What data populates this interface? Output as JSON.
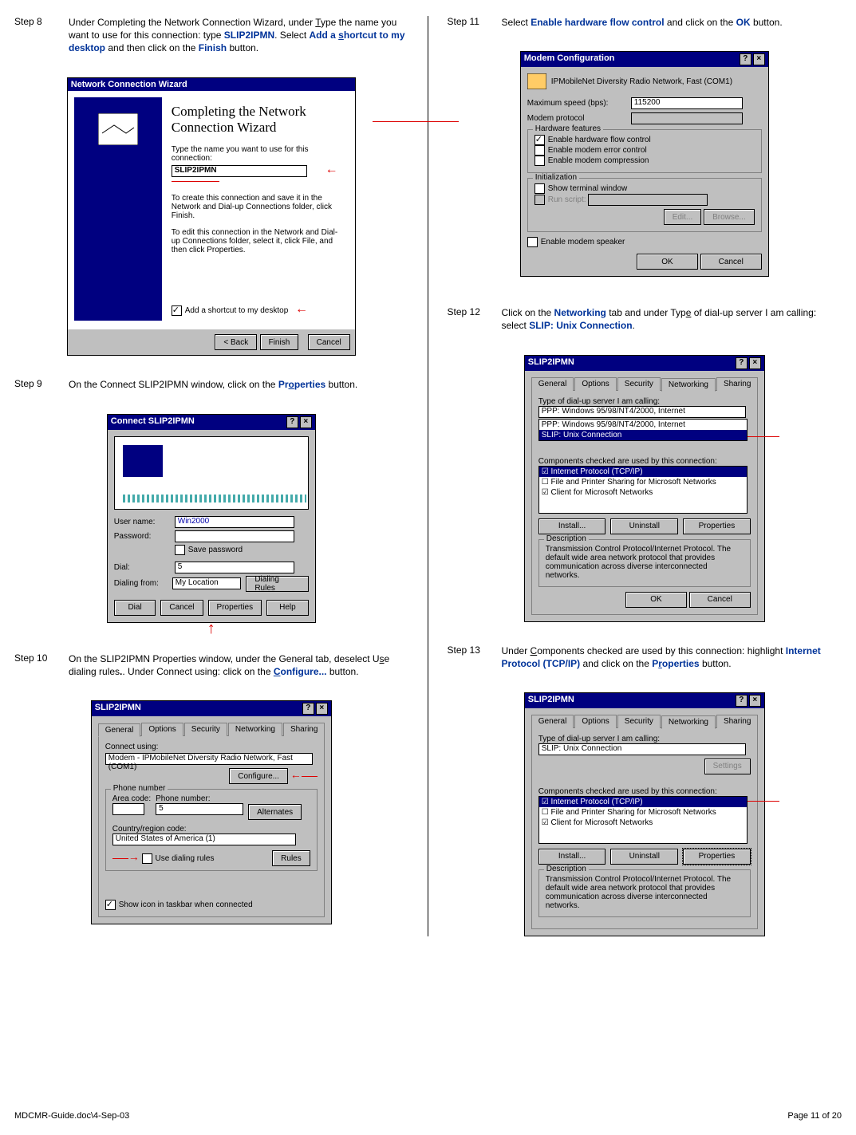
{
  "steps": {
    "s8": {
      "label": "Step 8",
      "text_a": "Under Completing the Network Connection Wizard, under ",
      "text_b": "ype the name you want to use for this connection: type ",
      "val1": "SLIP2IPMN",
      "text_c": ".  Select ",
      "val2": "Add a shortcut to my desktop",
      "text_d": " and then click on the ",
      "val3": "Finish",
      "text_e": " button.",
      "underline1": "T",
      "underline_s": "s"
    },
    "s9": {
      "label": "Step 9",
      "text_a": "On the Connect SLIP2IPMN window, click on the ",
      "val1": "Properties",
      "text_b": " button.",
      "u_o": "o"
    },
    "s10": {
      "label": "Step 10",
      "text_a": "On the SLIP2IPMN Properties window, under the General tab, deselect U",
      "u_s": "s",
      "text_b": "e dialing rules",
      "text_c": ".  Under Connect using: click on the ",
      "val1": "Configure...",
      "u_c": "C",
      "text_d": " button."
    },
    "s11": {
      "label": "Step 11",
      "text_a": "Select ",
      "val1": "Enable hardware flow control",
      "text_b": " and click on the ",
      "val2": "OK",
      "text_c": " button."
    },
    "s12": {
      "label": "Step 12",
      "text_a": "Click on the ",
      "val1": "Networking",
      "text_b": " tab and under Typ",
      "u_e": "e",
      "text_c": " of dial-up server I am calling: select ",
      "val2": "SLIP: Unix Connection",
      "text_d": "."
    },
    "s13": {
      "label": "Step 13",
      "text_a": "Under ",
      "u_C": "C",
      "text_b": "omponents checked are used by this connection: highlight ",
      "val1": "Internet Protocol (TCP/IP)",
      "text_c": " and click on the ",
      "val2": "Properties",
      "u_r": "r",
      "text_d": " button."
    }
  },
  "dlg8": {
    "title": "Network Connection Wizard",
    "h1": "Completing the Network Connection Wizard",
    "prompt": "Type the name you want to use for this connection:",
    "value": "SLIP2IPMN",
    "note1": "To create this connection and save it in the Network and Dial-up Connections folder, click Finish.",
    "note2": "To edit this connection in the Network and Dial-up Connections folder, select it, click File, and then click Properties.",
    "chk": "Add a shortcut to my desktop",
    "back": "< Back",
    "finish": "Finish",
    "cancel": "Cancel"
  },
  "dlg9": {
    "title": "Connect SLIP2IPMN",
    "user_l": "User name:",
    "user_v": "Win2000",
    "pass_l": "Password:",
    "save": "Save password",
    "dial_l": "Dial:",
    "dial_v": "5",
    "from_l": "Dialing from:",
    "from_v": "My Location",
    "rules": "Dialing Rules",
    "b_dial": "Dial",
    "b_cancel": "Cancel",
    "b_prop": "Properties",
    "b_help": "Help"
  },
  "dlg10": {
    "title": "SLIP2IPMN",
    "tab_general": "General",
    "tab_options": "Options",
    "tab_security": "Security",
    "tab_networking": "Networking",
    "tab_sharing": "Sharing",
    "connect_using": "Connect using:",
    "modem": "Modem - IPMobileNet Diversity Radio Network, Fast (COM1)",
    "configure": "Configure...",
    "phone_group": "Phone number",
    "area_l": "Area code:",
    "phone_l": "Phone number:",
    "phone_v": "5",
    "alt": "Alternates",
    "country_l": "Country/region code:",
    "country_v": "United States of America (1)",
    "usedial": "Use dialing rules",
    "rules": "Rules",
    "showicon": "Show icon in taskbar when connected"
  },
  "dlg11": {
    "title": "Modem Configuration",
    "device": "IPMobileNet Diversity Radio Network, Fast (COM1)",
    "max_l": "Maximum speed (bps):",
    "max_v": "115200",
    "proto_l": "Modem protocol",
    "hw_group": "Hardware features",
    "chk_flow": "Enable hardware flow control",
    "chk_err": "Enable modem error control",
    "chk_comp": "Enable modem compression",
    "init_group": "Initialization",
    "chk_term": "Show terminal window",
    "chk_script": "Run script:",
    "edit": "Edit...",
    "browse": "Browse...",
    "chk_spk": "Enable modem speaker",
    "ok": "OK",
    "cancel": "Cancel"
  },
  "dlg12": {
    "title": "SLIP2IPMN",
    "type_l": "Type of dial-up server I am calling:",
    "sel_v": "PPP: Windows 95/98/NT4/2000, Internet",
    "opt2": "PPP: Windows 95/98/NT4/2000, Internet",
    "opt3": "SLIP: Unix Connection",
    "comp_l": "Components checked are used by this connection:",
    "c1": "Internet Protocol (TCP/IP)",
    "c2": "File and Printer Sharing for Microsoft Networks",
    "c3": "Client for Microsoft Networks",
    "install": "Install...",
    "uninstall": "Uninstall",
    "props": "Properties",
    "desc_g": "Description",
    "desc": "Transmission Control Protocol/Internet Protocol. The default wide area network protocol that provides communication across diverse interconnected networks.",
    "ok": "OK",
    "cancel": "Cancel"
  },
  "dlg13": {
    "title": "SLIP2IPMN",
    "type_l": "Type of dial-up server I am calling:",
    "sel_v": "SLIP: Unix Connection",
    "settings": "Settings",
    "comp_l": "Components checked are used by this connection:",
    "c1": "Internet Protocol (TCP/IP)",
    "c2": "File and Printer Sharing for Microsoft Networks",
    "c3": "Client for Microsoft Networks",
    "install": "Install...",
    "uninstall": "Uninstall",
    "props": "Properties",
    "desc_g": "Description",
    "desc": "Transmission Control Protocol/Internet Protocol. The default wide area network protocol that provides communication across diverse interconnected networks."
  },
  "footer": {
    "left": "MDCMR-Guide.doc\\4-Sep-03",
    "right": "Page 11 of 20"
  }
}
